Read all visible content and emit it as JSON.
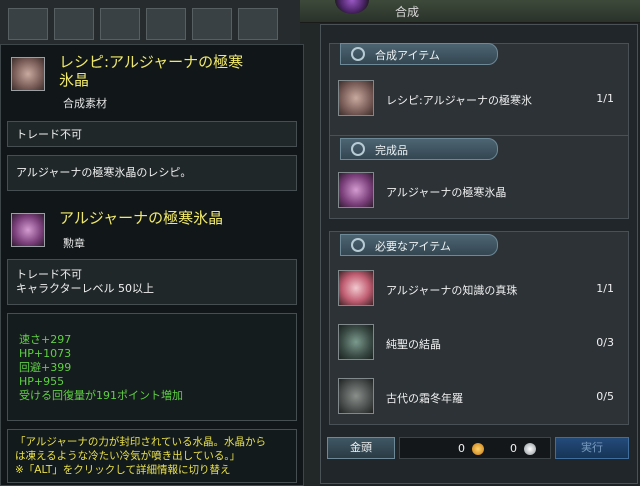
{
  "background": {
    "window_title": "合成"
  },
  "tooltip": {
    "item": {
      "name_line1": "レシピ:アルジャーナの極寒",
      "name_line2": "氷晶",
      "category": "合成素材",
      "trade": "トレード不可",
      "description": "アルジャーナの極寒氷晶のレシピ。"
    },
    "product": {
      "name": "アルジャーナの極寒氷晶",
      "category": "勲章",
      "trade": "トレード不可",
      "requirement": "キャラクターレベル 50以上",
      "stats": [
        "速さ+297",
        "HP+1073",
        "回避+399",
        "HP+955",
        "受ける回復量が191ポイント増加"
      ],
      "lore_line1": "「アルジャーナの力が封印されている水晶。水晶から",
      "lore_line2": "は凍えるような冷たい冷気が噴き出している。」",
      "hint": "※「ALT」をクリックして詳細情報に切り替え"
    }
  },
  "craft": {
    "sections": {
      "item": {
        "label": "合成アイテム",
        "name": "レシピ:アルジャーナの極寒氷",
        "qty": "1/1",
        "icon": "recipe-scroll-icon"
      },
      "result": {
        "label": "完成品",
        "name": "アルジャーナの極寒氷晶",
        "icon": "ice-crystal-icon"
      },
      "materials": {
        "label": "必要なアイテム",
        "items": [
          {
            "name": "アルジャーナの知識の真珠",
            "qty": "1/1",
            "icon": "pearl-icon"
          },
          {
            "name": "純聖の結晶",
            "qty": "0/3",
            "icon": "crystal-gem-icon"
          },
          {
            "name": "古代の霜冬年羅",
            "qty": "0/5",
            "icon": "shell-icon"
          }
        ]
      }
    },
    "footer": {
      "gold_label": "金頭",
      "gold_value": "0",
      "silver_value": "0",
      "craft_label": "実行"
    }
  },
  "colors": {
    "title_yellow": "#f0e86a",
    "stat_green": "#5fcf45",
    "tab_blue": "#4d6572",
    "craft_button": "#234b7a"
  }
}
